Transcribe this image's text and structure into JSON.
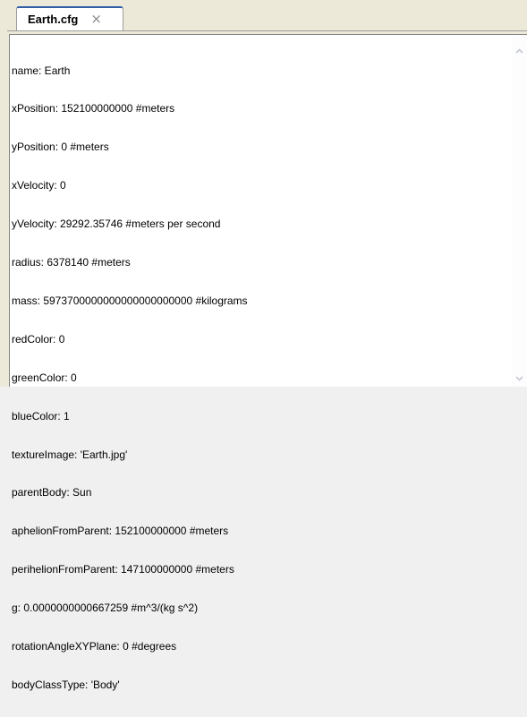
{
  "tab": {
    "title": "Earth.cfg",
    "close_glyph": "×"
  },
  "editor": {
    "lines": [
      "name: Earth",
      "xPosition: 152100000000 #meters",
      "yPosition: 0 #meters",
      "xVelocity: 0",
      "yVelocity: 29292.35746 #meters per second",
      "radius: 6378140 #meters",
      "mass: 5973700000000000000000000 #kilograms",
      "redColor: 0",
      "greenColor: 0",
      "blueColor: 1",
      "textureImage: 'Earth.jpg'",
      "parentBody: Sun",
      "aphelionFromParent: 152100000000 #meters",
      "perihelionFromParent: 147100000000 #meters",
      "g: 0.0000000000667259 #m^3/(kg s^2)",
      "rotationAngleXYPlane: 0 #degrees",
      "bodyClassType: 'Body'"
    ]
  },
  "icons": {
    "scroll_up": "chevron-up-icon",
    "scroll_down": "chevron-down-icon"
  },
  "colors": {
    "tab_accent": "#2f5da8",
    "background": "#f0f0f0",
    "editor_bg": "#ffffff"
  }
}
